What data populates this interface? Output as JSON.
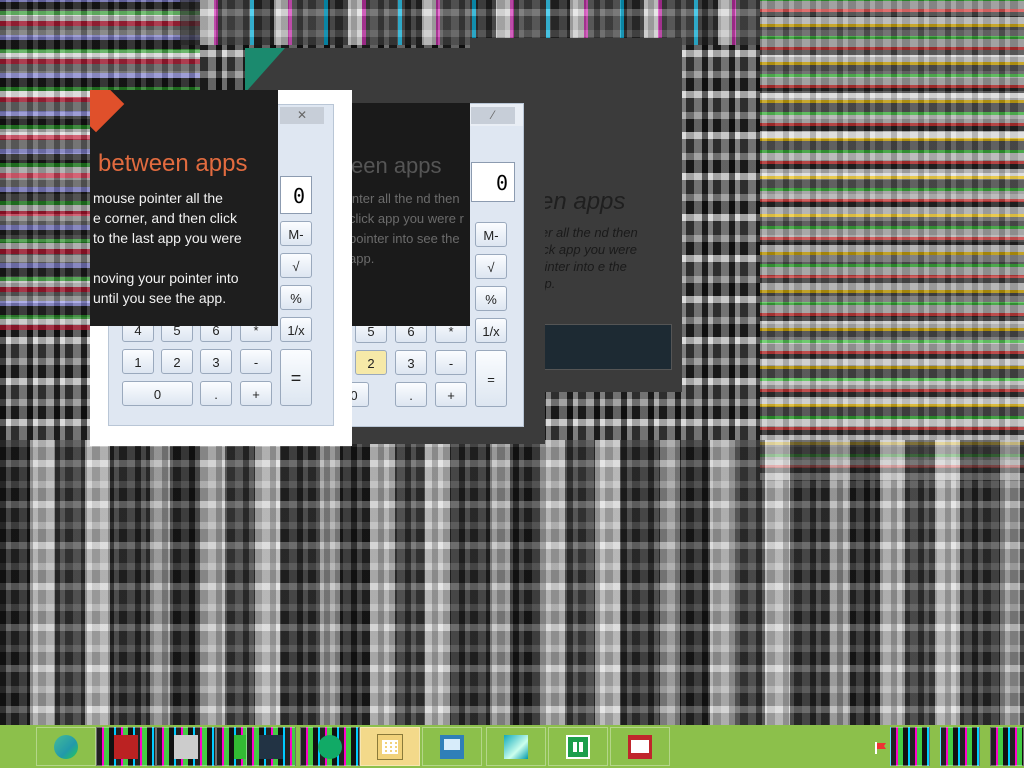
{
  "tip": {
    "heading": "between apps",
    "line1": "mouse pointer all the",
    "line2": "e corner, and then click",
    "line3": "to the last app you were",
    "line4": "",
    "line5": "noving your pointer into",
    "line6": "until you see the app."
  },
  "ghost_tip": {
    "heading": "een apps",
    "body": "inter all the nd then click app you were r pointer into see the app."
  },
  "ghost_tip_back": {
    "heading": "en apps",
    "body": "nter all the nd then click app you were pointer into e the app."
  },
  "calculator_front": {
    "display": "0",
    "close_label": "✕",
    "keys": [
      {
        "label": "M-"
      },
      {
        "label": "√"
      },
      {
        "label": "%"
      },
      {
        "label": "1/x"
      },
      {
        "label": "4"
      },
      {
        "label": "5"
      },
      {
        "label": "6"
      },
      {
        "label": "*"
      },
      {
        "label": "1"
      },
      {
        "label": "2"
      },
      {
        "label": "3"
      },
      {
        "label": "-"
      },
      {
        "label": "0"
      },
      {
        "label": "."
      },
      {
        "label": "+"
      },
      {
        "label": "="
      }
    ]
  },
  "calculator_back": {
    "display": "0",
    "keys": [
      {
        "label": "M-"
      },
      {
        "label": "√"
      },
      {
        "label": "%"
      },
      {
        "label": "1/x"
      },
      {
        "label": "5"
      },
      {
        "label": "6"
      },
      {
        "label": "*"
      },
      {
        "label": "2"
      },
      {
        "label": "3"
      },
      {
        "label": "-"
      },
      {
        "label": "0"
      },
      {
        "label": "."
      },
      {
        "label": "+"
      },
      {
        "label": "="
      }
    ]
  },
  "taskbar": {
    "items": [
      {
        "name": "media-player-icon"
      },
      {
        "name": "glitched-app-icon"
      },
      {
        "name": "glitched-app-icon-2"
      },
      {
        "name": "glitched-app-icon-3"
      },
      {
        "name": "glitched-app-icon-4"
      },
      {
        "name": "glitched-app-icon-5"
      },
      {
        "name": "calculator-icon"
      },
      {
        "name": "this-pc-icon"
      },
      {
        "name": "cube-app-icon"
      },
      {
        "name": "store-icon"
      },
      {
        "name": "reader-icon"
      }
    ],
    "accent": "#8cc04b"
  }
}
